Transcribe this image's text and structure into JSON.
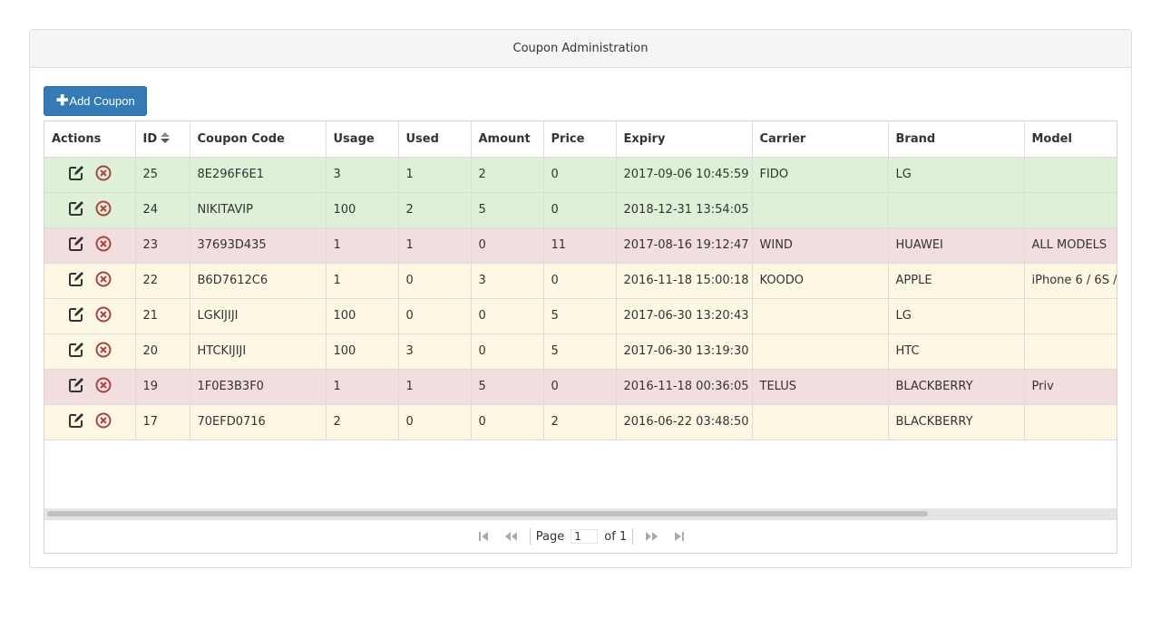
{
  "panel": {
    "title": "Coupon Administration"
  },
  "toolbar": {
    "add_label": "Add Coupon",
    "add_icon": "plus-icon"
  },
  "columns": [
    "Actions",
    "ID",
    "Coupon Code",
    "Usage",
    "Used",
    "Amount",
    "Price",
    "Expiry",
    "Carrier",
    "Brand",
    "Model"
  ],
  "sorted_column": "ID",
  "rows": [
    {
      "status": "success",
      "id": "25",
      "code": "8E296F6E1",
      "usage": "3",
      "used": "1",
      "amount": "2",
      "price": "0",
      "expiry": "2017-09-06 10:45:59",
      "carrier": "FIDO",
      "brand": "LG",
      "model": ""
    },
    {
      "status": "success",
      "id": "24",
      "code": "NIKITAVIP",
      "usage": "100",
      "used": "2",
      "amount": "5",
      "price": "0",
      "expiry": "2018-12-31 13:54:05",
      "carrier": "",
      "brand": "",
      "model": ""
    },
    {
      "status": "danger",
      "id": "23",
      "code": "37693D435",
      "usage": "1",
      "used": "1",
      "amount": "0",
      "price": "11",
      "expiry": "2017-08-16 19:12:47",
      "carrier": "WIND",
      "brand": "HUAWEI",
      "model": "ALL MODELS"
    },
    {
      "status": "warning",
      "id": "22",
      "code": "B6D7612C6",
      "usage": "1",
      "used": "0",
      "amount": "3",
      "price": "0",
      "expiry": "2016-11-18 15:00:18",
      "carrier": "KOODO",
      "brand": "APPLE",
      "model": "iPhone 6 / 6S /"
    },
    {
      "status": "warning",
      "id": "21",
      "code": "LGKIJIJI",
      "usage": "100",
      "used": "0",
      "amount": "0",
      "price": "5",
      "expiry": "2017-06-30 13:20:43",
      "carrier": "",
      "brand": "LG",
      "model": ""
    },
    {
      "status": "warning",
      "id": "20",
      "code": "HTCKIJIJI",
      "usage": "100",
      "used": "3",
      "amount": "0",
      "price": "5",
      "expiry": "2017-06-30 13:19:30",
      "carrier": "",
      "brand": "HTC",
      "model": ""
    },
    {
      "status": "danger",
      "id": "19",
      "code": "1F0E3B3F0",
      "usage": "1",
      "used": "1",
      "amount": "5",
      "price": "0",
      "expiry": "2016-11-18 00:36:05",
      "carrier": "TELUS",
      "brand": "BLACKBERRY",
      "model": "Priv"
    },
    {
      "status": "warning",
      "id": "17",
      "code": "70EFD0716",
      "usage": "2",
      "used": "0",
      "amount": "0",
      "price": "2",
      "expiry": "2016-06-22 03:48:50",
      "carrier": "",
      "brand": "BLACKBERRY",
      "model": ""
    }
  ],
  "row_action_icons": [
    "edit-icon",
    "delete-icon"
  ],
  "status_colors": {
    "success": "#dff0d8",
    "danger": "#f2dede",
    "warning": "#fcf8e3",
    "accent": "#337ab7"
  },
  "pager": {
    "page_label": "Page",
    "page_value": "1",
    "of_label": "of 1"
  }
}
